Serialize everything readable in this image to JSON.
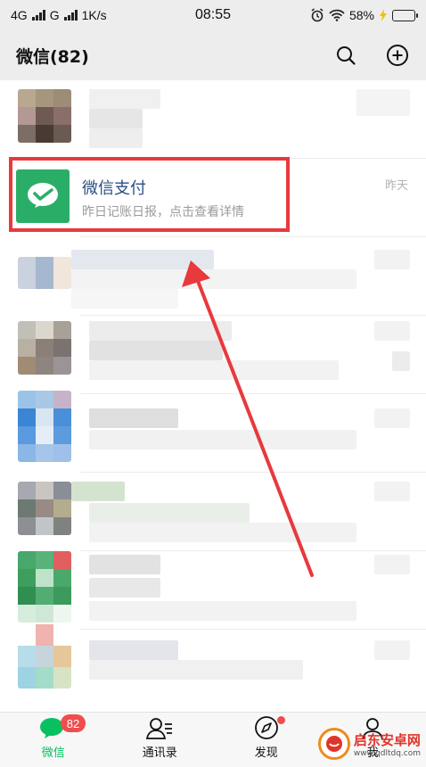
{
  "status_bar": {
    "net1": "4G",
    "net2": "G",
    "speed": "1K/s",
    "time": "08:55",
    "battery": "58%",
    "battery_level": 0.58
  },
  "header": {
    "title": "微信(82)",
    "search_icon": "search-icon",
    "add_icon": "plus-circle-icon"
  },
  "highlighted_chat": {
    "name": "微信支付",
    "preview": "昨日记账日报，点击查看详情",
    "time": "昨天"
  },
  "bottom_nav": {
    "items": [
      {
        "label": "微信",
        "badge": "82"
      },
      {
        "label": "通讯录"
      },
      {
        "label": "发现"
      },
      {
        "label": "我"
      }
    ]
  },
  "watermark": {
    "title": "启东安卓网",
    "url": "www.qdltdq.com"
  },
  "colors": {
    "accent": "#07c160",
    "pay_green": "#2aae67",
    "annotation_red": "#e8393c",
    "badge_red": "#f04d4d"
  }
}
